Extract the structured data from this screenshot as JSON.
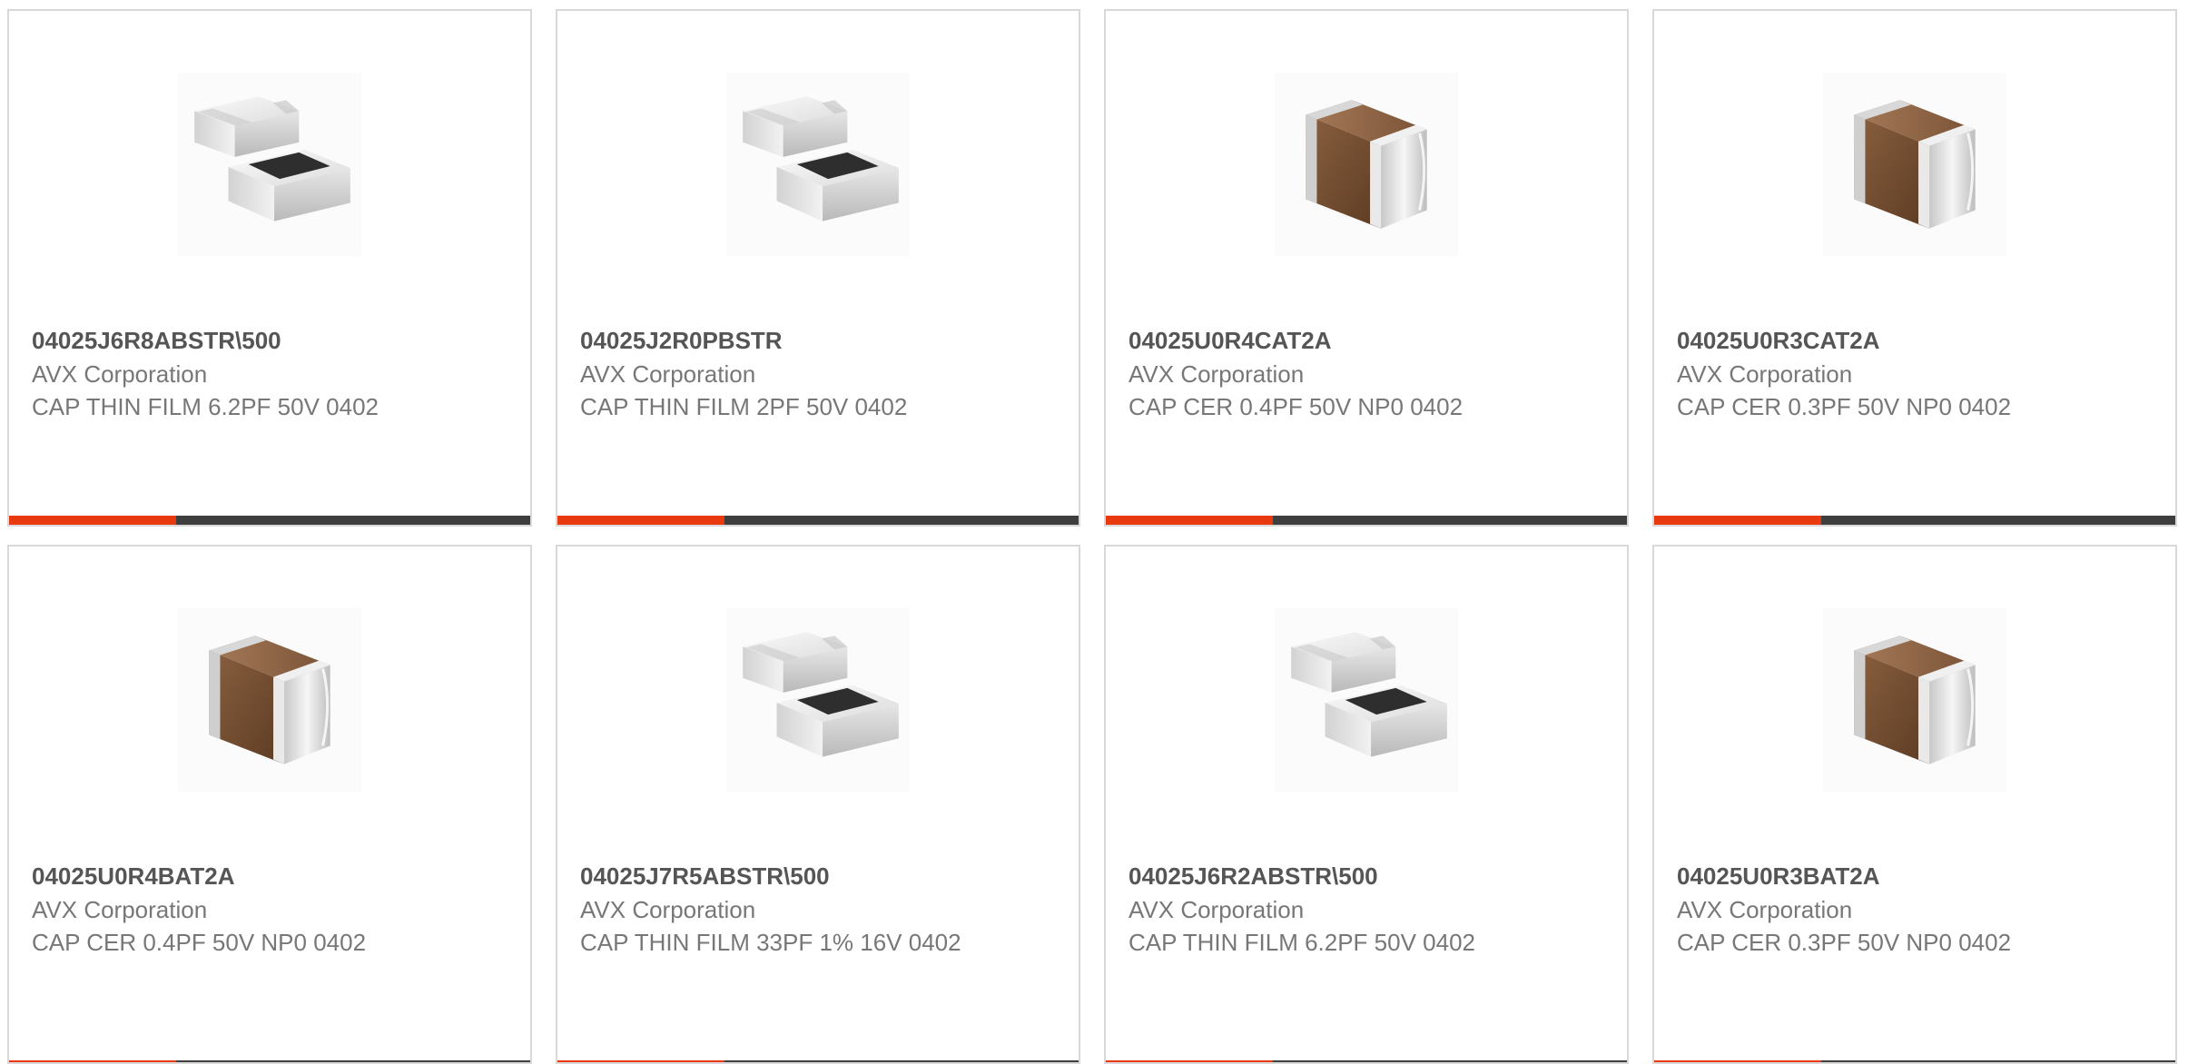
{
  "colors": {
    "accent": "#e8380d",
    "bar_dark": "#3e3e3e",
    "part_number": "#555555",
    "text_muted": "#777777",
    "card_border": "#d8d8d8"
  },
  "products": [
    {
      "part_number": "04025J6R8ABSTR\\500",
      "manufacturer": "AVX Corporation",
      "description": "CAP THIN FILM 6.2PF 50V 0402",
      "image": "thin-film-capacitor-image"
    },
    {
      "part_number": "04025J2R0PBSTR",
      "manufacturer": "AVX Corporation",
      "description": "CAP THIN FILM 2PF 50V 0402",
      "image": "thin-film-capacitor-image"
    },
    {
      "part_number": "04025U0R4CAT2A",
      "manufacturer": "AVX Corporation",
      "description": "CAP CER 0.4PF 50V NP0 0402",
      "image": "ceramic-capacitor-image"
    },
    {
      "part_number": "04025U0R3CAT2A",
      "manufacturer": "AVX Corporation",
      "description": "CAP CER 0.3PF 50V NP0 0402",
      "image": "ceramic-capacitor-image"
    },
    {
      "part_number": "04025U0R4BAT2A",
      "manufacturer": "AVX Corporation",
      "description": "CAP CER 0.4PF 50V NP0 0402",
      "image": "ceramic-capacitor-image"
    },
    {
      "part_number": "04025J7R5ABSTR\\500",
      "manufacturer": "AVX Corporation",
      "description": "CAP THIN FILM 33PF 1% 16V 0402",
      "image": "thin-film-capacitor-image"
    },
    {
      "part_number": "04025J6R2ABSTR\\500",
      "manufacturer": "AVX Corporation",
      "description": "CAP THIN FILM 6.2PF 50V 0402",
      "image": "thin-film-capacitor-image"
    },
    {
      "part_number": "04025U0R3BAT2A",
      "manufacturer": "AVX Corporation",
      "description": "CAP CER 0.3PF 50V NP0 0402",
      "image": "ceramic-capacitor-image"
    }
  ]
}
